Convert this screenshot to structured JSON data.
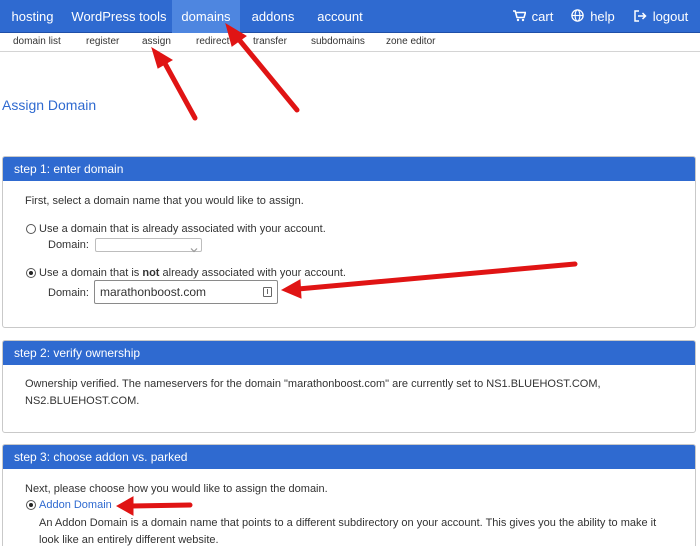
{
  "topnav": {
    "items": [
      {
        "label": "hosting"
      },
      {
        "label": "WordPress tools"
      },
      {
        "label": "domains",
        "active": true
      },
      {
        "label": "addons"
      },
      {
        "label": "account"
      }
    ],
    "right": [
      {
        "label": "cart",
        "icon": "cart-icon"
      },
      {
        "label": "help",
        "icon": "globe-icon"
      },
      {
        "label": "logout",
        "icon": "logout-icon"
      }
    ]
  },
  "subnav": {
    "items": [
      {
        "label": "domain list"
      },
      {
        "label": "register"
      },
      {
        "label": "assign"
      },
      {
        "label": "redirect"
      },
      {
        "label": "transfer"
      },
      {
        "label": "subdomains"
      },
      {
        "label": "zone editor"
      }
    ]
  },
  "page": {
    "title": "Assign Domain"
  },
  "step1": {
    "header": "step 1: enter domain",
    "intro": "First, select a domain name that you would like to assign.",
    "option_existing": "Use a domain that is already associated with your account.",
    "domain_label_1": "Domain:",
    "option_new_prefix": "Use a domain that is ",
    "option_new_bold": "not",
    "option_new_suffix": " already associated with your account.",
    "domain_label_2": "Domain:",
    "domain_value": "marathonboost.com"
  },
  "step2": {
    "header": "step 2: verify ownership",
    "message": "Ownership verified. The nameservers for the domain \"marathonboost.com\" are currently set to NS1.BLUEHOST.COM, NS2.BLUEHOST.COM."
  },
  "step3": {
    "header": "step 3: choose addon vs. parked",
    "intro": "Next, please choose how you would like to assign the domain.",
    "option_addon": "Addon Domain",
    "description": "An Addon Domain is a domain name that points to a different subdirectory on your account. This gives you the ability to make it look like an entirely different website."
  },
  "colors": {
    "nav_blue": "#2f6ad0",
    "nav_active": "#4e86e0",
    "arrow_red": "#e01414"
  }
}
